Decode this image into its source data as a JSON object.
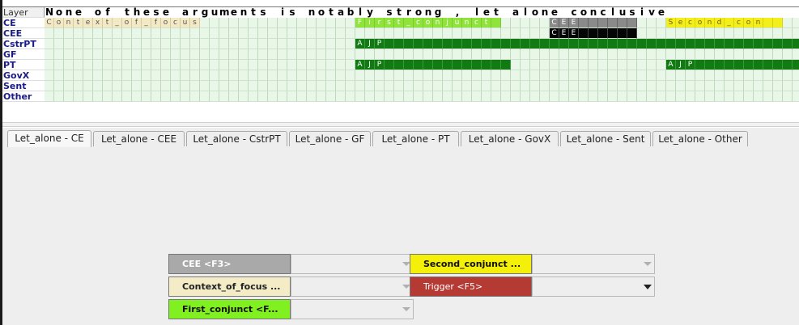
{
  "grid": {
    "header_label": "Layer",
    "sentence": "None of these arguments is notably strong , let alone conclusive",
    "layers": [
      "CE",
      "CEE",
      "CstrPT",
      "GF",
      "PT",
      "GovX",
      "Sent",
      "Other"
    ],
    "ce_spans": {
      "context_of_focus": "Context_of_focus",
      "first_conjunct": "First_conjunct",
      "cee": "CEE",
      "second_conjunct": "Second_con"
    },
    "cee_span": "CEE",
    "cstrpt_span": "AJP",
    "pt_span_1": "AJP",
    "pt_span_2": "AJP"
  },
  "tabs": [
    "Let_alone - CE",
    "Let_alone - CEE",
    "Let_alone - CstrPT",
    "Let_alone - GF",
    "Let_alone - PT",
    "Let_alone - GovX",
    "Let_alone - Sent",
    "Let_alone - Other"
  ],
  "active_tab": 0,
  "frame_elements": {
    "cee": "CEE <F3>",
    "context_of_focus": "Context_of_focus ...",
    "first_conjunct": "First_conjunct <F...",
    "second_conjunct": "Second_conjunct ...",
    "trigger": "Trigger <F5>"
  },
  "colors": {
    "cee": "#a9a9a9",
    "context_of_focus": "#f3ecc6",
    "first_conjunct": "#80f020",
    "second_conjunct": "#f5f00a",
    "trigger": "#b53a34",
    "ajp": "#127a12"
  },
  "icons": {
    "dropdown": "chevron-down-icon"
  }
}
